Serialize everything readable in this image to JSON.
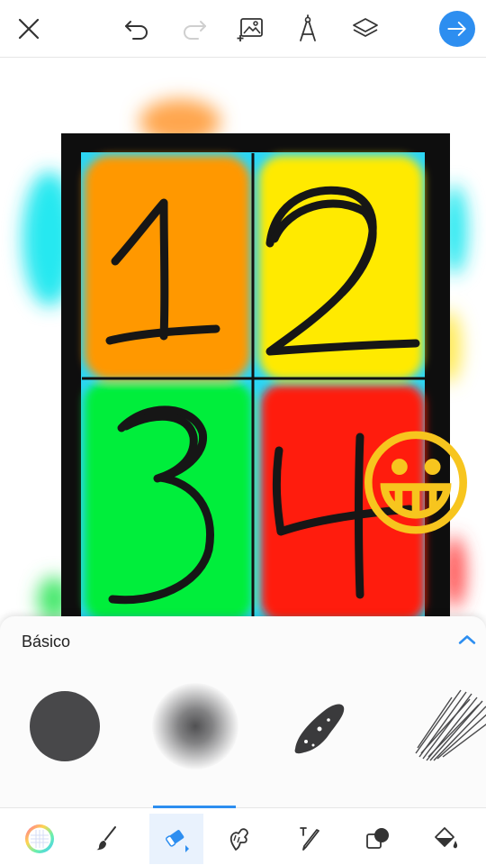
{
  "topbar": {
    "icons": [
      "close-icon",
      "undo-icon",
      "redo-icon",
      "add-image-icon",
      "ruler-compass-icon",
      "layers-icon",
      "next-arrow-icon"
    ],
    "accent": "#2d8ef0"
  },
  "canvas": {
    "cells": [
      {
        "number": "1",
        "color": "#ff9800"
      },
      {
        "number": "2",
        "color": "#ffea00"
      },
      {
        "number": "3",
        "color": "#00ee3a"
      },
      {
        "number": "4",
        "color": "#ff1a10"
      }
    ],
    "sticker": "😀"
  },
  "brush_panel": {
    "title": "Básico",
    "brushes": [
      "solid-round-brush",
      "soft-airbrush",
      "ink-splatter-brush",
      "pencil-texture-brush"
    ]
  },
  "bottom_toolbar": {
    "tools": [
      "color-picker-icon",
      "brush-icon",
      "eraser-icon",
      "smudge-icon",
      "text-icon",
      "layers-blend-icon",
      "fill-bucket-icon"
    ],
    "active": "eraser-icon"
  }
}
